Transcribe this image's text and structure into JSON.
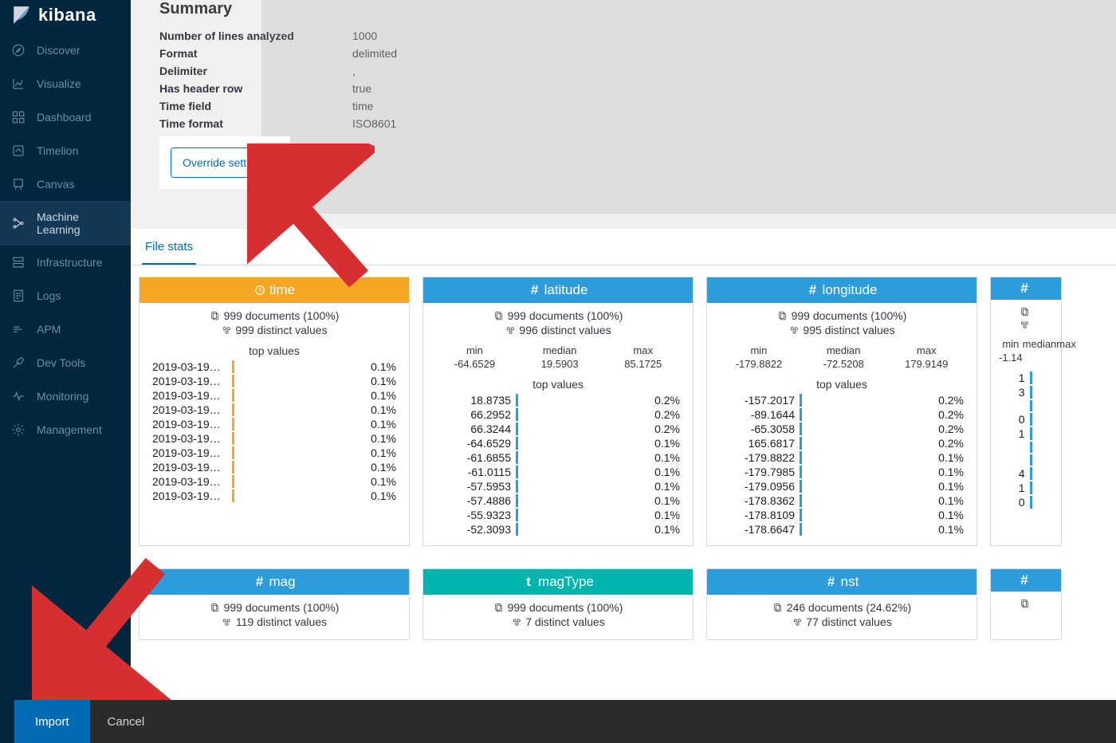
{
  "app_name": "kibana",
  "sidebar": {
    "items": [
      {
        "label": "Discover",
        "icon": "compass-icon"
      },
      {
        "label": "Visualize",
        "icon": "chart-icon"
      },
      {
        "label": "Dashboard",
        "icon": "dashboard-icon"
      },
      {
        "label": "Timelion",
        "icon": "timelion-icon"
      },
      {
        "label": "Canvas",
        "icon": "canvas-icon"
      },
      {
        "label": "Machine Learning",
        "icon": "ml-icon",
        "active": true
      },
      {
        "label": "Infrastructure",
        "icon": "infra-icon"
      },
      {
        "label": "Logs",
        "icon": "logs-icon"
      },
      {
        "label": "APM",
        "icon": "apm-icon"
      },
      {
        "label": "Dev Tools",
        "icon": "wrench-icon"
      },
      {
        "label": "Monitoring",
        "icon": "heartbeat-icon"
      },
      {
        "label": "Management",
        "icon": "gear-icon"
      }
    ]
  },
  "summary": {
    "title": "Summary",
    "rows": [
      {
        "k": "Number of lines analyzed",
        "v": "1000"
      },
      {
        "k": "Format",
        "v": "delimited"
      },
      {
        "k": "Delimiter",
        "v": ","
      },
      {
        "k": "Has header row",
        "v": "true"
      },
      {
        "k": "Time field",
        "v": "time"
      },
      {
        "k": "Time format",
        "v": "ISO8601"
      }
    ],
    "override_label": "Override settings"
  },
  "stats": {
    "tab_label": "File stats",
    "cards_row1": [
      {
        "name": "time",
        "type": "time",
        "color": "orange",
        "docs": "999 documents (100%)",
        "distinct": "999 distinct values",
        "top_label": "top values",
        "top": [
          {
            "l": "2019-03-19T0...",
            "p": "0.1%"
          },
          {
            "l": "2019-03-19T0...",
            "p": "0.1%"
          },
          {
            "l": "2019-03-19T0...",
            "p": "0.1%"
          },
          {
            "l": "2019-03-19T0...",
            "p": "0.1%"
          },
          {
            "l": "2019-03-19T0...",
            "p": "0.1%"
          },
          {
            "l": "2019-03-19T0...",
            "p": "0.1%"
          },
          {
            "l": "2019-03-19T0...",
            "p": "0.1%"
          },
          {
            "l": "2019-03-19T0...",
            "p": "0.1%"
          },
          {
            "l": "2019-03-19T0...",
            "p": "0.1%"
          },
          {
            "l": "2019-03-19T0...",
            "p": "0.1%"
          }
        ]
      },
      {
        "name": "latitude",
        "type": "number",
        "color": "blue",
        "docs": "999 documents (100%)",
        "distinct": "996 distinct values",
        "stats": {
          "min": "-64.6529",
          "median": "19.5903",
          "max": "85.1725"
        },
        "top_label": "top values",
        "top": [
          {
            "l": "18.8735",
            "p": "0.2%"
          },
          {
            "l": "66.2952",
            "p": "0.2%"
          },
          {
            "l": "66.3244",
            "p": "0.2%"
          },
          {
            "l": "-64.6529",
            "p": "0.1%"
          },
          {
            "l": "-61.6855",
            "p": "0.1%"
          },
          {
            "l": "-61.0115",
            "p": "0.1%"
          },
          {
            "l": "-57.5953",
            "p": "0.1%"
          },
          {
            "l": "-57.4886",
            "p": "0.1%"
          },
          {
            "l": "-55.9323",
            "p": "0.1%"
          },
          {
            "l": "-52.3093",
            "p": "0.1%"
          }
        ]
      },
      {
        "name": "longitude",
        "type": "number",
        "color": "blue",
        "docs": "999 documents (100%)",
        "distinct": "995 distinct values",
        "stats": {
          "min": "-179.8822",
          "median": "-72.5208",
          "max": "179.9149"
        },
        "top_label": "top values",
        "top": [
          {
            "l": "-157.2017",
            "p": "0.2%"
          },
          {
            "l": "-89.1644",
            "p": "0.2%"
          },
          {
            "l": "-65.3058",
            "p": "0.2%"
          },
          {
            "l": "165.6817",
            "p": "0.2%"
          },
          {
            "l": "-179.8822",
            "p": "0.1%"
          },
          {
            "l": "-179.7985",
            "p": "0.1%"
          },
          {
            "l": "-179.0956",
            "p": "0.1%"
          },
          {
            "l": "-178.8362",
            "p": "0.1%"
          },
          {
            "l": "-178.8109",
            "p": "0.1%"
          },
          {
            "l": "-178.6647",
            "p": "0.1%"
          }
        ]
      },
      {
        "name": "",
        "type": "number",
        "color": "blue",
        "partial": true,
        "docs": "",
        "distinct": "",
        "stats": {
          "min": "-1.14",
          "median": "",
          "max": ""
        },
        "top_label": "",
        "top": [
          {
            "l": "1",
            "p": ""
          },
          {
            "l": "3",
            "p": ""
          },
          {
            "l": "",
            "p": ""
          },
          {
            "l": "0",
            "p": ""
          },
          {
            "l": "1",
            "p": ""
          },
          {
            "l": "",
            "p": ""
          },
          {
            "l": "",
            "p": ""
          },
          {
            "l": "4",
            "p": ""
          },
          {
            "l": "1",
            "p": ""
          },
          {
            "l": "0",
            "p": ""
          }
        ]
      }
    ],
    "cards_row2": [
      {
        "name": "mag",
        "type": "number",
        "color": "blue",
        "docs": "999 documents (100%)",
        "distinct": "119 distinct values"
      },
      {
        "name": "magType",
        "type": "text",
        "color": "teal",
        "docs": "999 documents (100%)",
        "distinct": "7 distinct values"
      },
      {
        "name": "nst",
        "type": "number",
        "color": "blue",
        "docs": "246 documents (24.62%)",
        "distinct": "77 distinct values"
      },
      {
        "name": "",
        "type": "number",
        "color": "blue",
        "partial": true,
        "docs": "",
        "distinct": ""
      }
    ]
  },
  "footer": {
    "import_label": "Import",
    "cancel_label": "Cancel"
  },
  "stat_labels": {
    "min": "min",
    "median": "median",
    "max": "max"
  }
}
